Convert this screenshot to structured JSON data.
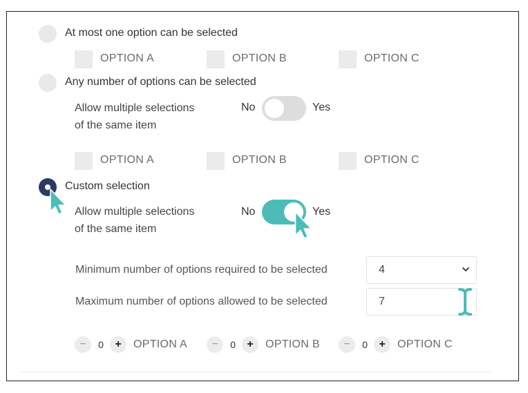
{
  "section1": {
    "label": "At most one option can be selected",
    "options": [
      "OPTION A",
      "OPTION B",
      "OPTION C"
    ]
  },
  "section2": {
    "label": "Any number of options can be selected",
    "allow_multiple_line1": "Allow multiple selections",
    "allow_multiple_line2": "of the same item",
    "toggle_no": "No",
    "toggle_yes": "Yes",
    "toggle_on": false,
    "options": [
      "OPTION A",
      "OPTION B",
      "OPTION C"
    ]
  },
  "section3": {
    "label": "Custom selection",
    "allow_multiple_line1": "Allow multiple selections",
    "allow_multiple_line2": "of the same item",
    "toggle_no": "No",
    "toggle_yes": "Yes",
    "toggle_on": true,
    "min_label": "Minimum number of options required to be selected",
    "min_value": "4",
    "max_label": "Maximum number of options allowed to be selected",
    "max_value": "7",
    "steppers": [
      {
        "count": "0",
        "label": "OPTION A"
      },
      {
        "count": "0",
        "label": "OPTION B"
      },
      {
        "count": "0",
        "label": "OPTION C"
      }
    ],
    "minus": "−",
    "plus": "+"
  },
  "colors": {
    "accent": "#4dbcb6",
    "selected_radio": "#2b3a67",
    "unselected": "#e9e9e9"
  },
  "icons": [
    "chevron-down-icon",
    "pointer-cursor-icon",
    "text-cursor-icon"
  ]
}
